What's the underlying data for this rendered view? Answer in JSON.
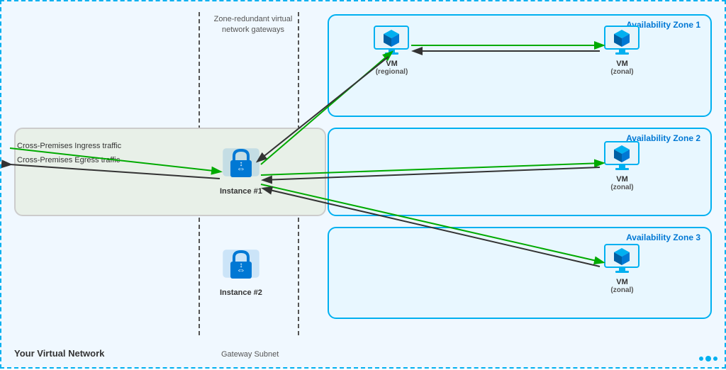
{
  "diagram": {
    "title": "Your Virtual Network",
    "gateway_subnet": "Gateway Subnet",
    "zone_redundant_label": "Zone-redundant virtual network gateways",
    "cross_premises_ingress": "Cross-Premises Ingress traffic",
    "cross_premises_egress": "Cross-Premises Egress traffic",
    "zones": [
      {
        "id": "az1",
        "label": "Availability Zone 1"
      },
      {
        "id": "az2",
        "label": "Availability Zone 2"
      },
      {
        "id": "az3",
        "label": "Availability Zone 3"
      }
    ],
    "instances": [
      {
        "id": "instance1",
        "label": "Instance #1"
      },
      {
        "id": "instance2",
        "label": "Instance #2"
      }
    ],
    "vms": [
      {
        "id": "vm-regional",
        "label": "VM",
        "sublabel": "(regional)"
      },
      {
        "id": "vm-zonal-1",
        "label": "VM",
        "sublabel": "(zonal)"
      },
      {
        "id": "vm-zonal-2",
        "label": "VM",
        "sublabel": "(zonal)"
      },
      {
        "id": "vm-zonal-3",
        "label": "VM",
        "sublabel": "(zonal)"
      }
    ],
    "colors": {
      "blue_border": "#00b0f0",
      "green_arrow": "#00aa00",
      "black_arrow": "#222222",
      "light_blue_bg": "#e8f7ff",
      "zone_border": "#00b0f0"
    }
  }
}
